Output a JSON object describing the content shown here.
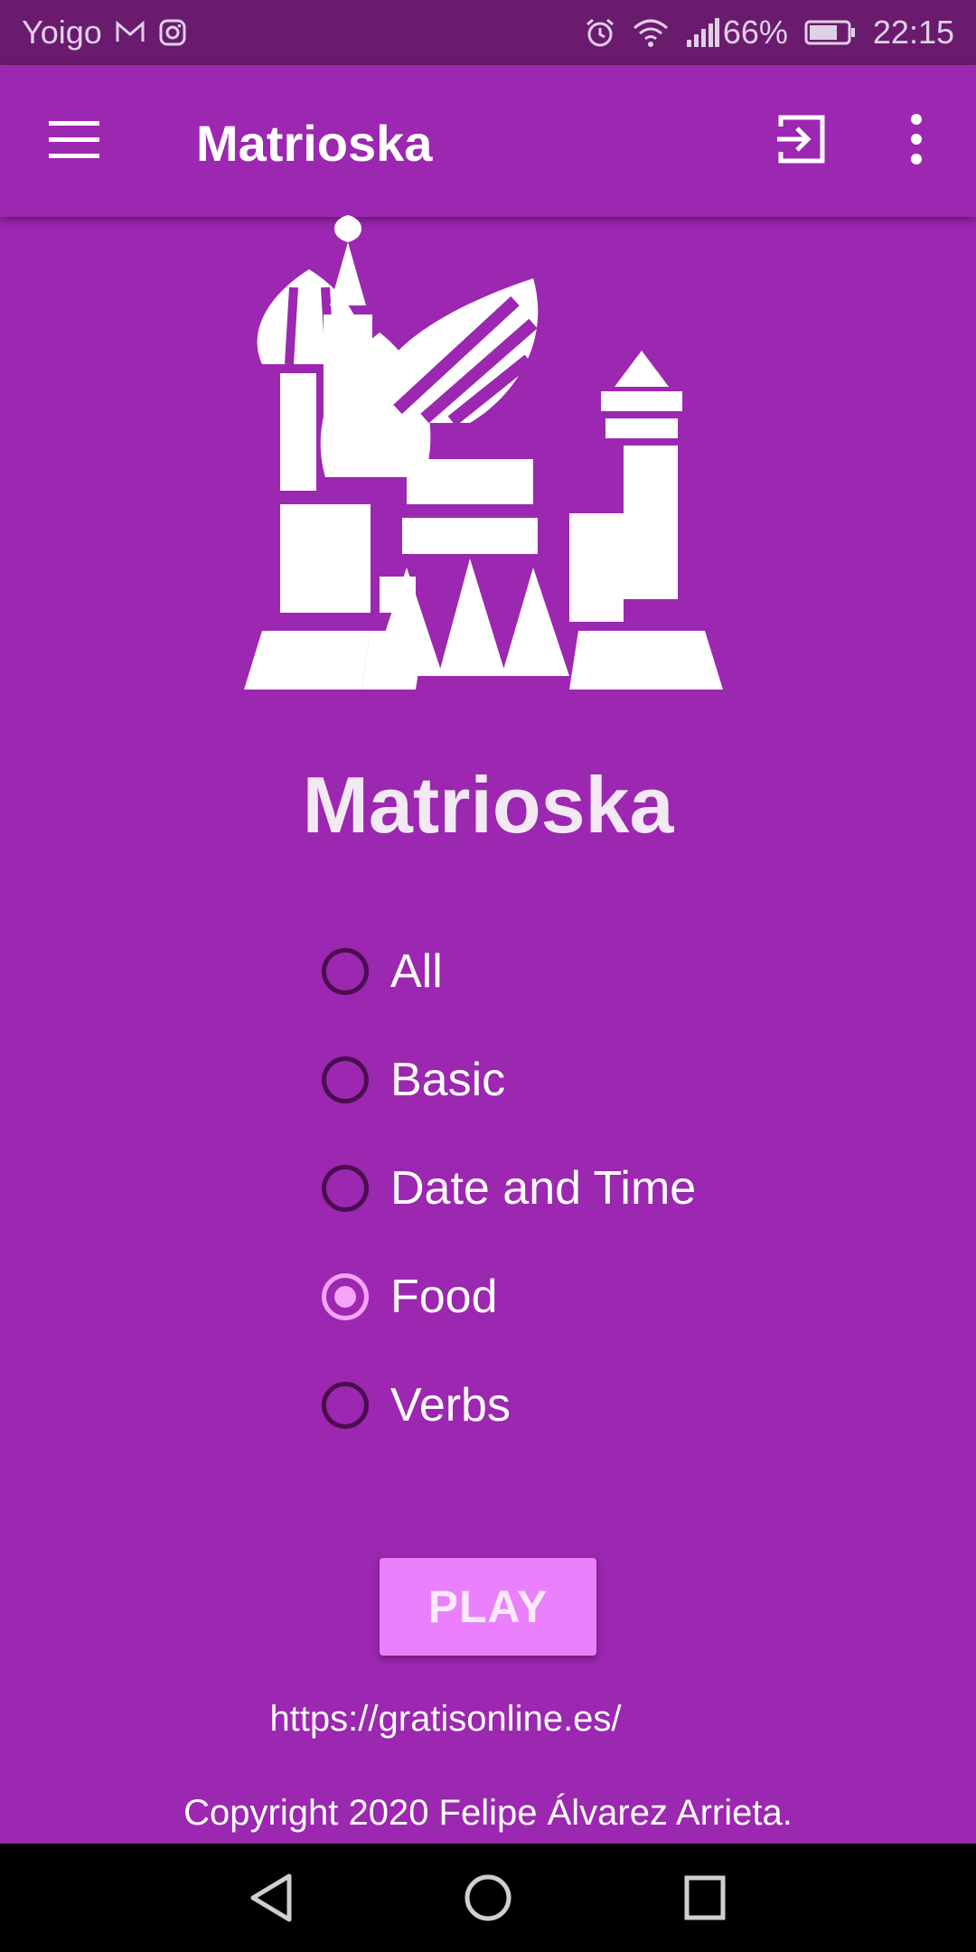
{
  "status_bar": {
    "carrier": "Yoigo",
    "battery": "66%",
    "time": "22:15",
    "icons": [
      "mail-icon",
      "instagram-icon",
      "alarm-icon",
      "wifi-icon",
      "signal-icon",
      "battery-icon"
    ]
  },
  "app_bar": {
    "title": "Matrioska",
    "icons": [
      "menu-icon",
      "login-icon",
      "more-vert-icon"
    ]
  },
  "main": {
    "logo": "cathedral-logo",
    "title": "Matrioska",
    "categories": [
      {
        "label": "All",
        "selected": false
      },
      {
        "label": "Basic",
        "selected": false
      },
      {
        "label": "Date and Time",
        "selected": false
      },
      {
        "label": "Food",
        "selected": true
      },
      {
        "label": "Verbs",
        "selected": false
      }
    ],
    "play_label": "PLAY",
    "link": "https://gratisonline.es/",
    "copyright": "Copyright 2020 Felipe Álvarez Arrieta."
  },
  "nav_bar": {
    "icons": [
      "back-icon",
      "home-icon",
      "recents-icon"
    ]
  },
  "colors": {
    "primary": "#9c27b0",
    "status_bar": "#6a1b6e",
    "accent": "#ea80fc",
    "radio_unchecked": "#4a0d4f",
    "radio_checked": "#f6a4f8"
  }
}
